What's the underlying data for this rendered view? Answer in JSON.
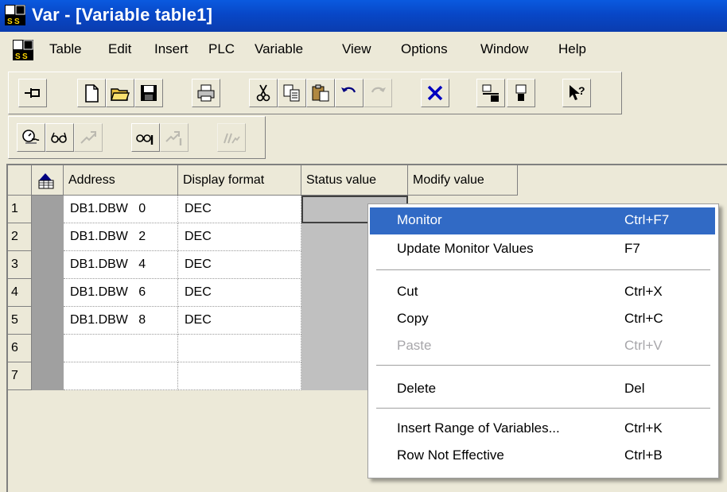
{
  "window": {
    "title": "Var - [Variable table1]"
  },
  "menubar": {
    "items": [
      "Table",
      "Edit",
      "Insert",
      "PLC",
      "Variable",
      "View",
      "Options",
      "Window",
      "Help"
    ]
  },
  "toolbar1": {
    "icons": [
      "pin-icon",
      "new-icon",
      "open-icon",
      "save-icon",
      "print-icon",
      "cut-icon",
      "copy-icon",
      "paste-icon",
      "undo-icon",
      "redo-icon",
      "delete-icon",
      "network-icon",
      "station-icon",
      "help-pointer-icon"
    ]
  },
  "toolbar2": {
    "icons": [
      "monitor-glasses-icon",
      "monitor-once-icon",
      "modify-icon",
      "monitor-update-icon",
      "modify-once-icon",
      "force-icon"
    ]
  },
  "table": {
    "headers": {
      "address": "Address",
      "display_format": "Display format",
      "status_value": "Status value",
      "modify_value": "Modify value"
    },
    "rows": [
      {
        "num": "1",
        "address": "DB1.DBW   0",
        "format": "DEC"
      },
      {
        "num": "2",
        "address": "DB1.DBW   2",
        "format": "DEC"
      },
      {
        "num": "3",
        "address": "DB1.DBW   4",
        "format": "DEC"
      },
      {
        "num": "4",
        "address": "DB1.DBW   6",
        "format": "DEC"
      },
      {
        "num": "5",
        "address": "DB1.DBW   8",
        "format": "DEC"
      },
      {
        "num": "6",
        "address": "",
        "format": ""
      },
      {
        "num": "7",
        "address": "",
        "format": ""
      }
    ]
  },
  "context_menu": {
    "items": [
      {
        "label": "Monitor",
        "shortcut": "Ctrl+F7",
        "state": "selected"
      },
      {
        "label": "Update Monitor Values",
        "shortcut": "F7",
        "state": "enabled"
      },
      {
        "label": "Cut",
        "shortcut": "Ctrl+X",
        "state": "enabled"
      },
      {
        "label": "Copy",
        "shortcut": "Ctrl+C",
        "state": "enabled"
      },
      {
        "label": "Paste",
        "shortcut": "Ctrl+V",
        "state": "disabled"
      },
      {
        "label": "Delete",
        "shortcut": "Del",
        "state": "enabled"
      },
      {
        "label": "Insert Range of Variables...",
        "shortcut": "Ctrl+K",
        "state": "enabled"
      },
      {
        "label": "Row Not Effective",
        "shortcut": "Ctrl+B",
        "state": "enabled"
      }
    ]
  },
  "colors": {
    "titlebar": "#0a5adf",
    "menu_highlight": "#316ac5",
    "face": "#ece9d8"
  }
}
